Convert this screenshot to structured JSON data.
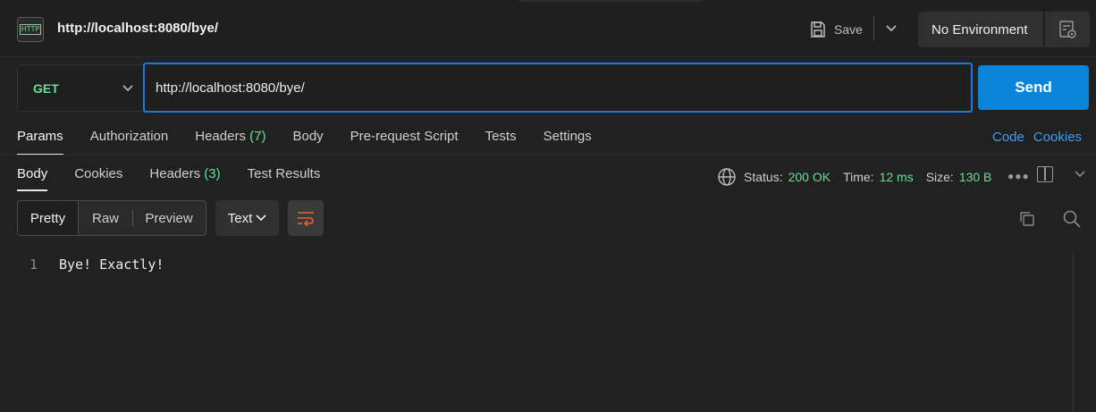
{
  "header": {
    "tab_title": "http://localhost:8080/bye/",
    "http_icon_text": "HTTP",
    "save_label": "Save",
    "environment": "No Environment"
  },
  "request": {
    "method": "GET",
    "url": "http://localhost:8080/bye/",
    "send_label": "Send",
    "tabs": [
      {
        "label": "Params",
        "active": true
      },
      {
        "label": "Authorization"
      },
      {
        "label": "Headers",
        "count": "(7)"
      },
      {
        "label": "Body"
      },
      {
        "label": "Pre-request Script"
      },
      {
        "label": "Tests"
      },
      {
        "label": "Settings"
      }
    ],
    "links": {
      "code": "Code",
      "cookies": "Cookies"
    }
  },
  "response": {
    "tabs": [
      {
        "label": "Body",
        "active": true
      },
      {
        "label": "Cookies"
      },
      {
        "label": "Headers",
        "count": "(3)"
      },
      {
        "label": "Test Results"
      }
    ],
    "status_label": "Status:",
    "status_value": "200 OK",
    "time_label": "Time:",
    "time_value": "12 ms",
    "size_label": "Size:",
    "size_value": "130 B",
    "view_modes": [
      "Pretty",
      "Raw",
      "Preview"
    ],
    "format": "Text",
    "lines": [
      {
        "no": "1",
        "text": "Bye! Exactly!"
      }
    ]
  },
  "colors": {
    "accent": "#0a84d8",
    "url_border": "#1f7ae0",
    "success": "#6bdd9a",
    "link": "#3b9ef5"
  }
}
